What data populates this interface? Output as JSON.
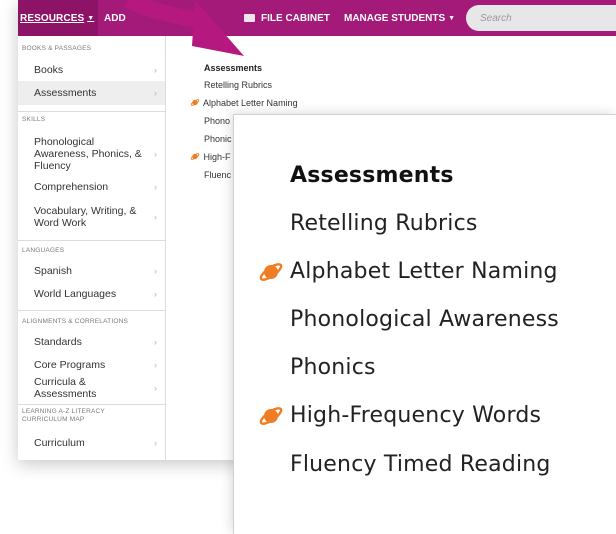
{
  "navbar": {
    "resources_label": "RESOURCES",
    "add_label": "ADD",
    "file_cabinet_label": "FILE CABINET",
    "manage_students_label": "MANAGE STUDENTS",
    "search_placeholder": "Search"
  },
  "sidebar": {
    "sections": [
      {
        "label": "BOOKS & PASSAGES",
        "items": [
          "Books",
          "Assessments"
        ]
      },
      {
        "label": "SKILLS",
        "items": [
          "Phonological Awareness, Phonics, & Fluency",
          "Comprehension",
          "Vocabulary, Writing, & Word Work"
        ]
      },
      {
        "label": "LANGUAGES",
        "items": [
          "Spanish",
          "World Languages"
        ]
      },
      {
        "label": "ALIGNMENTS & CORRELATIONS",
        "items": [
          "Standards",
          "Core Programs",
          "Curricula & Assessments"
        ]
      },
      {
        "label": "LEARNING A-Z LITERACY CURRICULUM MAP",
        "items": [
          "Curriculum"
        ]
      }
    ],
    "active_item": "Assessments"
  },
  "submenu": {
    "heading": "Assessments",
    "items": [
      {
        "label": "Retelling Rubrics",
        "icon": ""
      },
      {
        "label": "Alphabet Letter Naming",
        "icon": "planet-icon"
      },
      {
        "label": "Phonological Awareness",
        "icon": ""
      },
      {
        "label": "Phonics",
        "icon": ""
      },
      {
        "label": "High-Frequency Words",
        "icon": "planet-icon"
      },
      {
        "label": "Fluency Timed Reading",
        "icon": ""
      }
    ],
    "clipped": {
      "heading": "Assessments",
      "phono": "Phono",
      "phonic": "Phonic",
      "high": "High-F",
      "fluenc": "Fluenc"
    }
  },
  "colors": {
    "navbar": "#a31a78",
    "resources_tab": "#8c1366",
    "arrow": "#b5197f",
    "planet_icon": "#f07d23"
  }
}
